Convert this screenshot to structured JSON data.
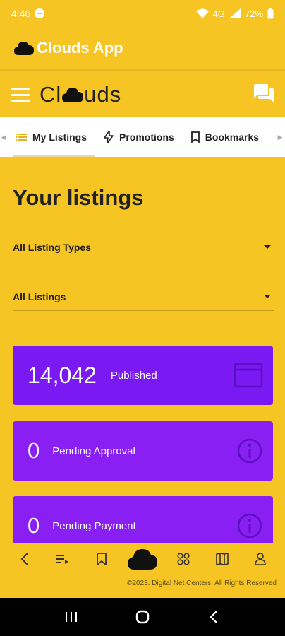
{
  "status_bar": {
    "time": "4:46",
    "network": "4G",
    "battery": "72%"
  },
  "app_header": {
    "title": "Clouds App"
  },
  "brand": {
    "prefix": "Cl",
    "suffix": "uds"
  },
  "tabs": [
    {
      "label": "My Listings",
      "icon": "list-icon",
      "active": true
    },
    {
      "label": "Promotions",
      "icon": "lightning-icon",
      "active": false
    },
    {
      "label": "Bookmarks",
      "icon": "bookmark-icon",
      "active": false
    }
  ],
  "main": {
    "title": "Your listings",
    "filters": {
      "type_value": "All Listing Types",
      "status_value": "All Listings"
    },
    "stats": [
      {
        "value": "14,042",
        "label": "Published",
        "icon": "browser-window-icon"
      },
      {
        "value": "0",
        "label": "Pending Approval",
        "icon": "info-icon"
      },
      {
        "value": "0",
        "label": "Pending Payment",
        "icon": "info-icon"
      }
    ]
  },
  "bottom_nav": [
    "back-icon",
    "playlist-icon",
    "bookmark-icon",
    "cloud-logo-icon",
    "apps-icon",
    "map-icon",
    "user-icon"
  ],
  "footer": "©2023. Digital Net Centers. All Rights Reserved",
  "colors": {
    "background": "#F6C524",
    "card": "#7A19F2",
    "card_pending": "#8A1FF3",
    "tab_bg": "#FFFFFF",
    "text": "#222222"
  }
}
